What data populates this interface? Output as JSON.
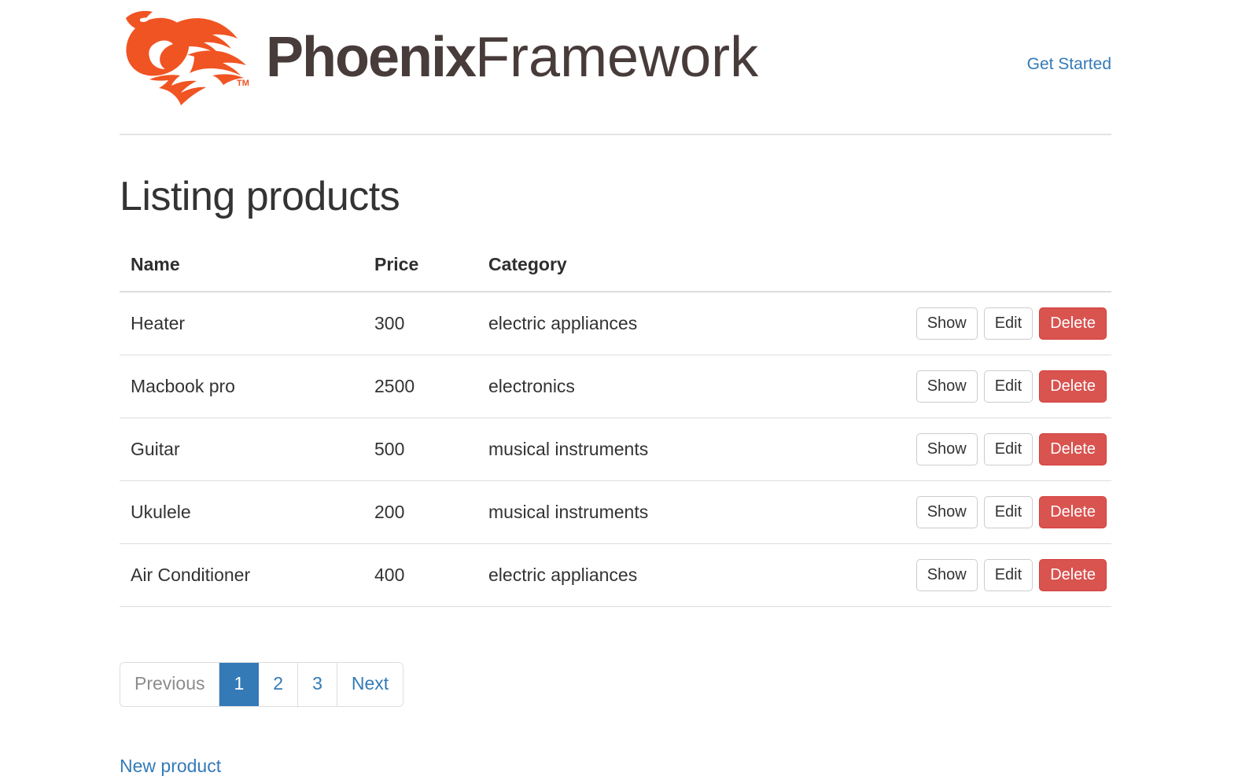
{
  "header": {
    "logo_icon": "phoenix-bird-logo",
    "logo_color": "#f05423",
    "wordmark_bold": "Phoenix",
    "wordmark_light": "Framework",
    "wordmark_color": "#483C3B",
    "trademark": "TM",
    "nav": {
      "get_started_label": "Get Started",
      "link_color": "#337ab7"
    }
  },
  "main": {
    "page_title": "Listing products",
    "table": {
      "columns": [
        "Name",
        "Price",
        "Category",
        ""
      ],
      "rows": [
        {
          "name": "Heater",
          "price": "300",
          "category": "electric appliances",
          "actions": {
            "show": "Show",
            "edit": "Edit",
            "delete": "Delete"
          }
        },
        {
          "name": "Macbook pro",
          "price": "2500",
          "category": "electronics",
          "actions": {
            "show": "Show",
            "edit": "Edit",
            "delete": "Delete"
          }
        },
        {
          "name": "Guitar",
          "price": "500",
          "category": "musical instruments",
          "actions": {
            "show": "Show",
            "edit": "Edit",
            "delete": "Delete"
          }
        },
        {
          "name": "Ukulele",
          "price": "200",
          "category": "musical instruments",
          "actions": {
            "show": "Show",
            "edit": "Edit",
            "delete": "Delete"
          }
        },
        {
          "name": "Air Conditioner",
          "price": "400",
          "category": "electric appliances",
          "actions": {
            "show": "Show",
            "edit": "Edit",
            "delete": "Delete"
          }
        }
      ]
    },
    "pagination": {
      "previous_label": "Previous",
      "pages": [
        "1",
        "2",
        "3"
      ],
      "active_page": "1",
      "next_label": "Next",
      "active_color": "#337ab7",
      "disabled_color": "#8c8c8c"
    },
    "new_product_label": "New product"
  },
  "colors": {
    "danger": "#d9534f",
    "link": "#337ab7",
    "brand_orange": "#f05423",
    "border": "#dddddd"
  }
}
